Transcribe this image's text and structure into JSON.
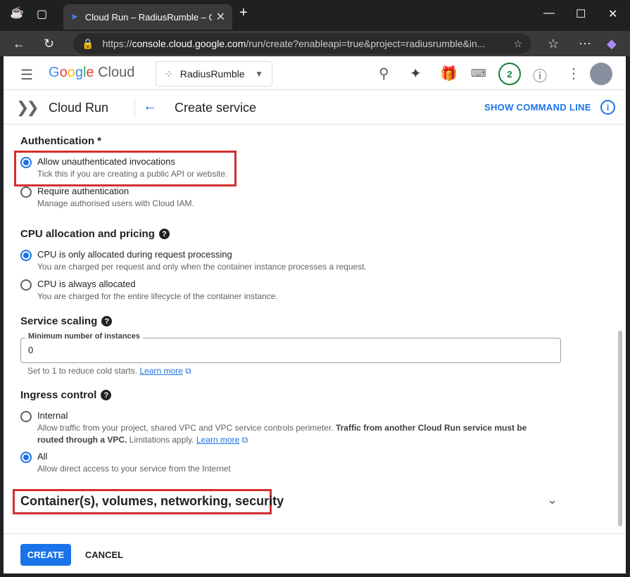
{
  "browser": {
    "tab_title": "Cloud Run – RadiusRumble – Google Cloud console",
    "url_prefix": "https://",
    "url_host": "console.cloud.google.com",
    "url_path": "/run/create?enableapi=true&project=radiusrumble&in..."
  },
  "header": {
    "logo_google": "Google",
    "logo_cloud": "Cloud",
    "project": "RadiusRumble",
    "notification_count": "2"
  },
  "subheader": {
    "product": "Cloud Run",
    "title": "Create service",
    "command_line": "SHOW COMMAND LINE"
  },
  "authentication": {
    "title": "Authentication *",
    "options": [
      {
        "label": "Allow unauthenticated invocations",
        "desc": "Tick this if you are creating a public API or website.",
        "checked": true
      },
      {
        "label": "Require authentication",
        "desc": "Manage authorised users with Cloud IAM.",
        "checked": false
      }
    ]
  },
  "cpu": {
    "title": "CPU allocation and pricing",
    "options": [
      {
        "label": "CPU is only allocated during request processing",
        "desc": "You are charged per request and only when the container instance processes a request.",
        "checked": true
      },
      {
        "label": "CPU is always allocated",
        "desc": "You are charged for the entire lifecycle of the container instance.",
        "checked": false
      }
    ]
  },
  "scaling": {
    "title": "Service scaling",
    "field_label": "Minimum number of instances",
    "field_value": "0",
    "hint": "Set to 1 to reduce cold starts.",
    "hint_link": "Learn more"
  },
  "ingress": {
    "title": "Ingress control",
    "internal_label": "Internal",
    "internal_desc_1": "Allow traffic from your project, shared VPC and VPC service controls perimeter.",
    "internal_desc_bold": "Traffic from another Cloud Run service must be routed through a VPC.",
    "internal_desc_2": "Limitations apply.",
    "internal_link": "Learn more",
    "all_label": "All",
    "all_desc": "Allow direct access to your service from the Internet"
  },
  "expander": {
    "title": "Container(s), volumes, networking, security"
  },
  "footer": {
    "create": "CREATE",
    "cancel": "CANCEL"
  },
  "colors": {
    "accent": "#1a73e8",
    "highlight": "#d32f2f"
  }
}
